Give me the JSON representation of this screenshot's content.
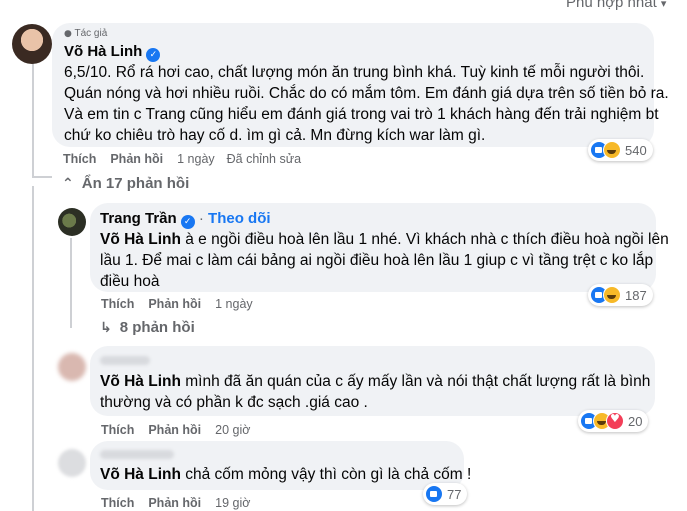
{
  "sort": {
    "label": "Phù hợp nhất"
  },
  "comment1": {
    "badge": "Tác giả",
    "author": "Võ Hà Linh",
    "lines": [
      "6,5/10. Rổ rá hơi cao, chất lượng món ăn trung bình khá. Tuỳ kinh tế mỗi người thôi.",
      "Quán nóng và hơi nhiều ruồi. Chắc do có mắm tôm. Em đánh giá dựa trên số tiền bỏ ra.",
      "Và em tin c Trang cũng hiểu em đánh giá trong vai trò 1 khách hàng đến trải nghiệm bt",
      "chứ ko chiêu trò hay cố d. ìm gì cả. Mn đừng kích war làm gì."
    ],
    "like": "Thích",
    "reply": "Phản hồi",
    "time": "1 ngày",
    "edited": "Đã chỉnh sửa",
    "reactions": "540",
    "hide_replies": "Ẩn 17 phản hồi"
  },
  "comment2": {
    "author": "Trang Trần",
    "follow": "Theo dõi",
    "mention": "Võ Hà Linh",
    "lines": [
      " à e ngồi điều hoà lên lầu 1 nhé. Vì khách nhà c thích điều hoà ngồi lên",
      "lầu 1. Để mai c làm cái bảng ai ngồi điều hoà lên lầu 1 giup c vì tầng trệt c ko lắp",
      "điều hoà"
    ],
    "like": "Thích",
    "reply": "Phản hồi",
    "time": "1 ngày",
    "reactions": "187",
    "more_replies": "8 phản hồi"
  },
  "comment3": {
    "mention": "Võ Hà Linh",
    "lines": [
      " mình đã ăn quán của c ấy mấy lần và nói thật chất lượng rất là bình",
      "thường và có phần k đc sạch .giá cao ."
    ],
    "like": "Thích",
    "reply": "Phản hồi",
    "time": "20 giờ",
    "reactions": "20"
  },
  "comment4": {
    "mention": "Võ Hà Linh",
    "text": " chả cốm mỏng vậy thì còn gì là chả cốm !",
    "like": "Thích",
    "reply": "Phản hồi",
    "time": "19 giờ",
    "reactions": "77"
  }
}
